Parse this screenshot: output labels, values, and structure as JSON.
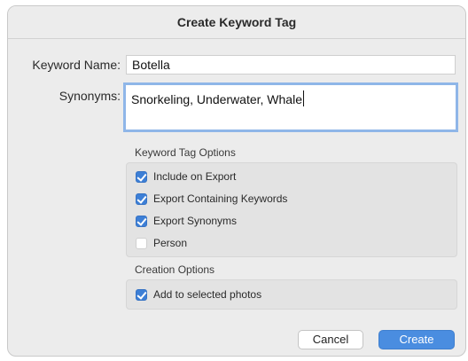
{
  "dialog": {
    "title": "Create Keyword Tag"
  },
  "form": {
    "keyword_name_label": "Keyword Name:",
    "keyword_name_value": "Botella",
    "synonyms_label": "Synonyms:",
    "synonyms_value": "Snorkeling, Underwater, Whale"
  },
  "keyword_tag_options": {
    "title": "Keyword Tag Options",
    "items": [
      {
        "label": "Include on Export",
        "checked": true
      },
      {
        "label": "Export Containing Keywords",
        "checked": true
      },
      {
        "label": "Export Synonyms",
        "checked": true
      },
      {
        "label": "Person",
        "checked": false
      }
    ]
  },
  "creation_options": {
    "title": "Creation Options",
    "items": [
      {
        "label": "Add to selected photos",
        "checked": true
      }
    ]
  },
  "buttons": {
    "cancel": "Cancel",
    "create": "Create"
  },
  "colors": {
    "accent": "#3d7fd6",
    "dialog_bg": "#ececec",
    "group_bg": "#e3e3e3",
    "focus_ring": "#8fb6e8"
  }
}
